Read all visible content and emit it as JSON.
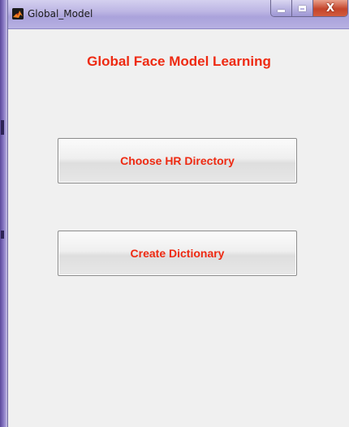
{
  "window": {
    "title": "Global_Model",
    "app_icon": "matlab-icon",
    "controls": {
      "minimize_icon": "minimize-icon",
      "maximize_icon": "maximize-icon",
      "close_label": "X"
    }
  },
  "main": {
    "heading": "Global Face Model Learning",
    "buttons": {
      "choose_hr": "Choose HR Directory",
      "create_dictionary": "Create Dictionary"
    }
  },
  "colors": {
    "text_accent": "#ee2a12",
    "panel_background": "#f0f0f0",
    "titlebar": "#bdb6e4"
  }
}
